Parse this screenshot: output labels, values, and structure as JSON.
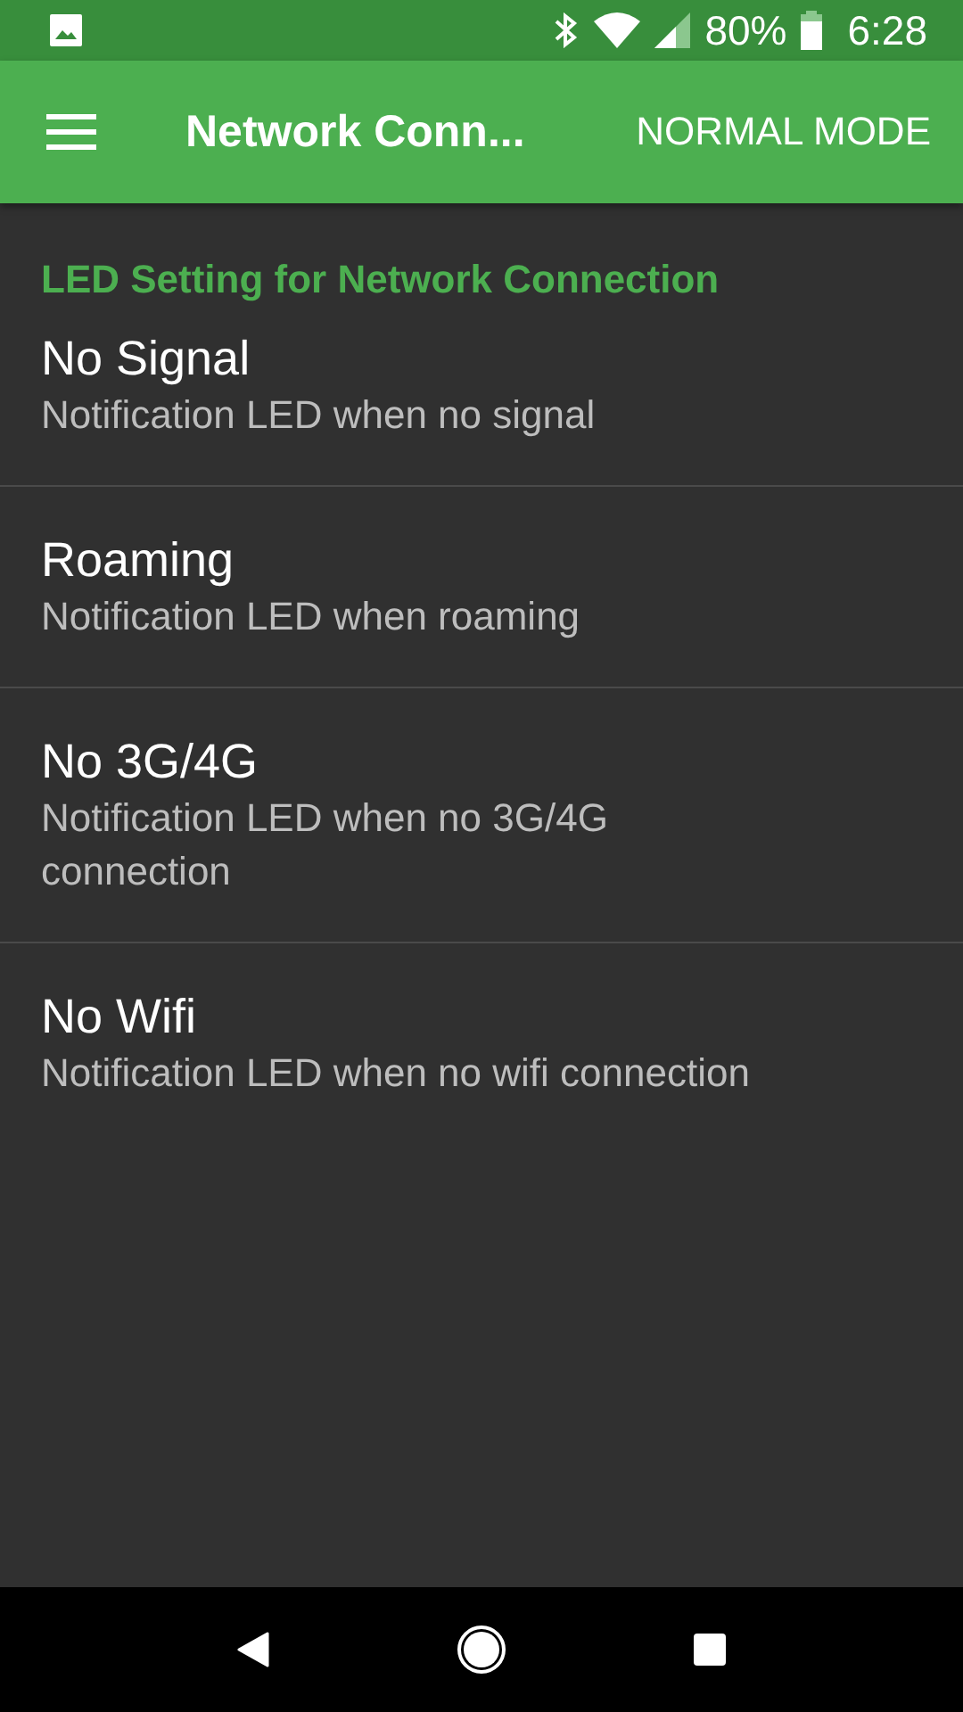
{
  "status_bar": {
    "battery": "80%",
    "time": "6:28"
  },
  "app_bar": {
    "title": "Network Conn...",
    "action": "NORMAL MODE"
  },
  "section": {
    "header": "LED Setting for Network Connection"
  },
  "items": [
    {
      "title": "No Signal",
      "summary": "Notification LED when no signal"
    },
    {
      "title": "Roaming",
      "summary": "Notification LED when roaming"
    },
    {
      "title": "No 3G/4G",
      "summary": "Notification LED when no 3G/4G connection"
    },
    {
      "title": "No Wifi",
      "summary": "Notification LED when no wifi connection"
    }
  ]
}
